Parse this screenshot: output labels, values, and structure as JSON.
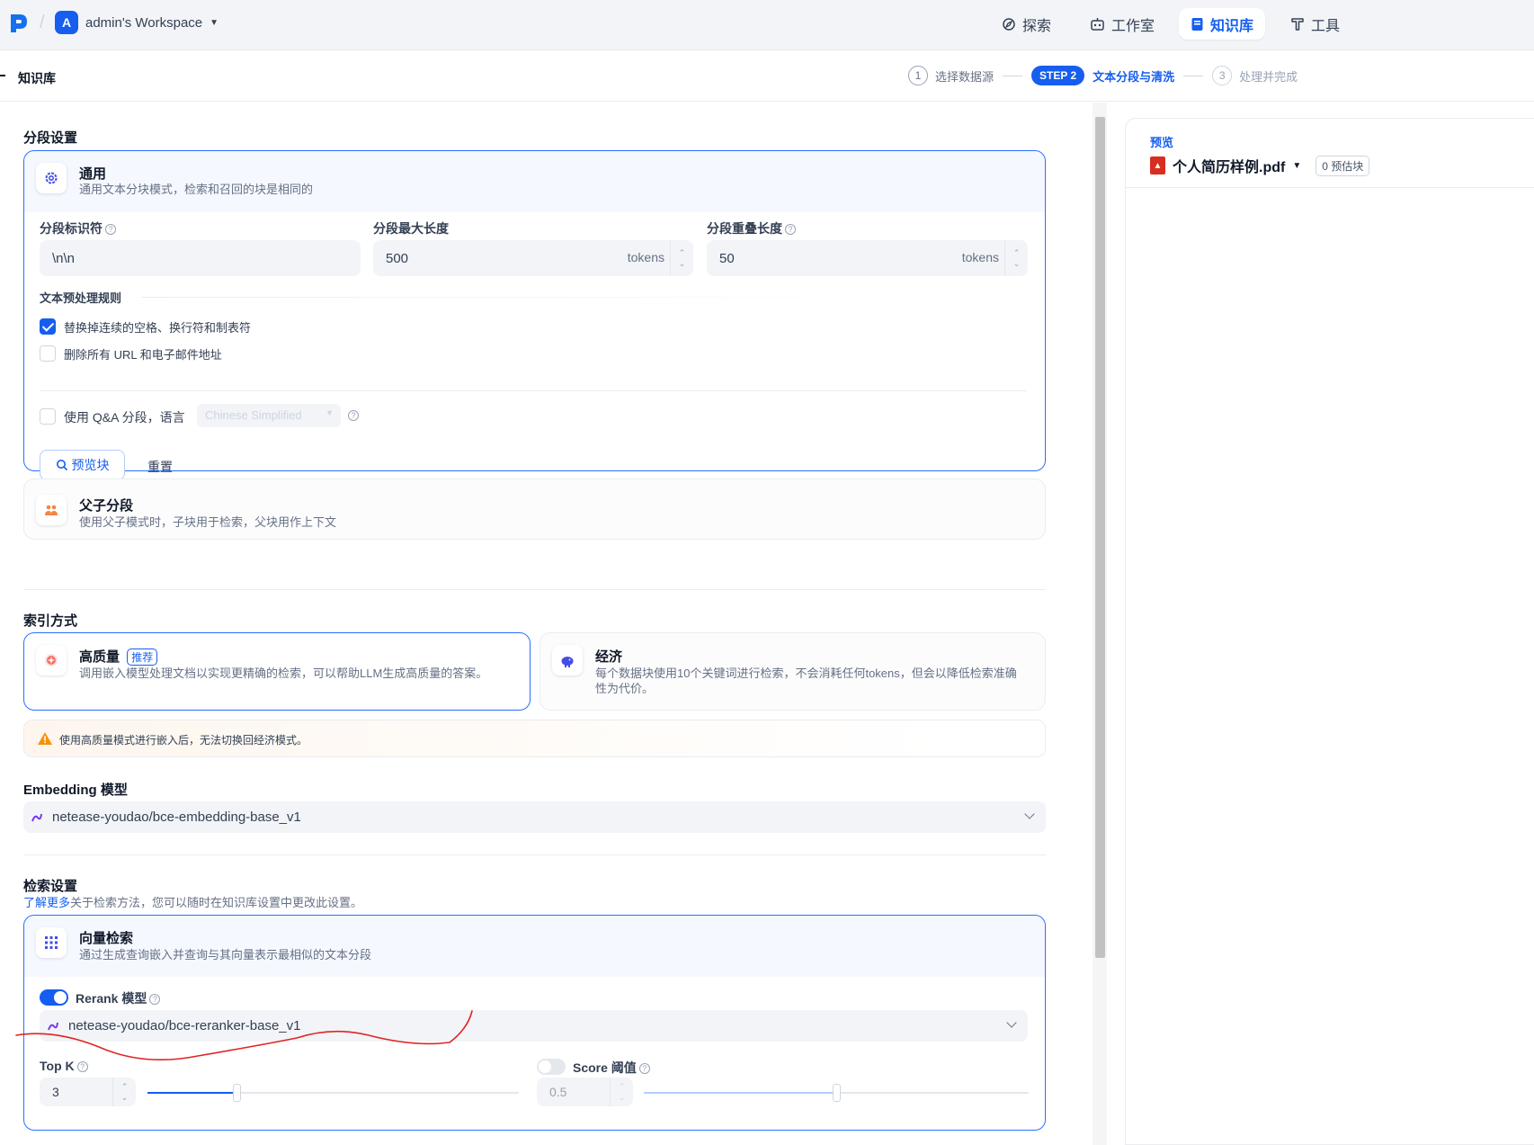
{
  "header": {
    "workspace_initial": "A",
    "workspace_name": "admin's Workspace",
    "nav": [
      {
        "label": "探索",
        "icon": "compass-icon"
      },
      {
        "label": "工作室",
        "icon": "robot-icon"
      },
      {
        "label": "知识库",
        "icon": "book-icon",
        "active": true
      },
      {
        "label": "工具",
        "icon": "hammer-icon"
      }
    ]
  },
  "breadcrumb": {
    "label": "知识库"
  },
  "steps": [
    {
      "num": "1",
      "label": "选择数据源"
    },
    {
      "num": "STEP 2",
      "label": "文本分段与清洗"
    },
    {
      "num": "3",
      "label": "处理并完成"
    }
  ],
  "segment": {
    "section_title": "分段设置",
    "general": {
      "title": "通用",
      "desc": "通用文本分块模式，检索和召回的块是相同的",
      "delimiter_label": "分段标识符",
      "delimiter_value": "\\n\\n",
      "maxlen_label": "分段最大长度",
      "maxlen_value": "500",
      "overlap_label": "分段重叠长度",
      "overlap_value": "50",
      "unit": "tokens",
      "rules_label": "文本预处理规则",
      "rule1": "替换掉连续的空格、换行符和制表符",
      "rule1_checked": true,
      "rule2": "删除所有 URL 和电子邮件地址",
      "rule2_checked": false,
      "qa_label": "使用 Q&A 分段，语言",
      "qa_lang": "Chinese Simplified",
      "preview_btn": "预览块",
      "reset_btn": "重置"
    },
    "parent_child": {
      "title": "父子分段",
      "desc": "使用父子模式时，子块用于检索，父块用作上下文"
    }
  },
  "index": {
    "section_title": "索引方式",
    "high": {
      "title": "高质量",
      "tag": "推荐",
      "desc": "调用嵌入模型处理文档以实现更精确的检索，可以帮助LLM生成高质量的答案。"
    },
    "eco": {
      "title": "经济",
      "desc_line1": "每个数据块使用10个关键词进行检索，不会消耗任何tokens，但会以降低检索准确",
      "desc_line2": "性为代价。"
    },
    "warning": "使用高质量模式进行嵌入后，无法切换回经济模式。"
  },
  "embedding": {
    "label": "Embedding 模型",
    "value": "netease-youdao/bce-embedding-base_v1"
  },
  "retrieval": {
    "title": "检索设置",
    "learn_more": "了解更多",
    "desc": "关于检索方法，您可以随时在知识库设置中更改此设置。",
    "vector": {
      "title": "向量检索",
      "desc": "通过生成查询嵌入并查询与其向量表示最相似的文本分段"
    },
    "rerank_label": "Rerank 模型",
    "rerank_on": true,
    "rerank_value": "netease-youdao/bce-reranker-base_v1",
    "topk_label": "Top K",
    "topk_value": "3",
    "topk_fraction": 0.24,
    "score_label": "Score 阈值",
    "score_on": false,
    "score_value": "0.5",
    "score_fraction": 0.5
  },
  "preview": {
    "title": "预览",
    "file": "个人简历样例.pdf",
    "count": "0 预估块"
  }
}
